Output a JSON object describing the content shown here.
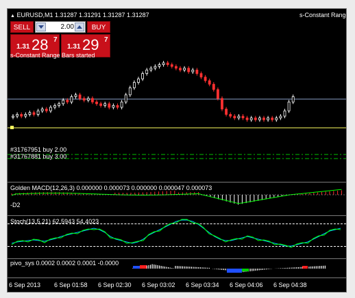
{
  "chart": {
    "symbol_info": "EURUSD,M1  1.31287 1.31291 1.31287 1.31287",
    "indicator_name_right": "s-Constant Range",
    "status_text": "s-Constant Range Bars started",
    "order1": "#31767951 buy 2.00",
    "order2": "#31767881 buy 3.00"
  },
  "trade_panel": {
    "sell_label": "SELL",
    "buy_label": "BUY",
    "lot_value": "2.00",
    "sell_small": "1.31",
    "sell_big": "28",
    "sell_sup": "7",
    "buy_small": "1.31",
    "buy_big": "29",
    "buy_sup": "7"
  },
  "macd": {
    "label": "Golden MACD(12,26,3) 0.000000 0.000073 0.000000 0.000047 0.000073",
    "sub_label": "-D2"
  },
  "stoch": {
    "label": "Stoch(13,5,21) 62.5943 54.4023"
  },
  "bottom_ind": {
    "label": "pivo_sys 0.0002 0.0002 0.0001 -0.0000"
  },
  "time_axis": [
    "6 Sep 2013",
    "6 Sep 01:58",
    "6 Sep 02:30",
    "6 Sep 03:02",
    "6 Sep 03:34",
    "6 Sep 04:06",
    "6 Sep 04:38"
  ],
  "colors": {
    "candle_up": "#ffffff",
    "candle_down": "#ff3030",
    "hline_blue": "#8aa0c8",
    "hline_yellow": "#ffff60",
    "order_line": "#00c000"
  },
  "price_series": [
    {
      "o": 0,
      "c": 0
    },
    {
      "o": 0,
      "c": 1
    },
    {
      "o": 1,
      "c": 0
    },
    {
      "o": 0,
      "c": 1
    },
    {
      "o": 1,
      "c": 2
    },
    {
      "o": 2,
      "c": 1
    },
    {
      "o": 1,
      "c": 3
    },
    {
      "o": 3,
      "c": 4
    },
    {
      "o": 4,
      "c": 3
    },
    {
      "o": 3,
      "c": 5
    },
    {
      "o": 5,
      "c": 6
    },
    {
      "o": 6,
      "c": 7
    },
    {
      "o": 7,
      "c": 9
    },
    {
      "o": 9,
      "c": 8
    },
    {
      "o": 8,
      "c": 11
    },
    {
      "o": 11,
      "c": 12
    },
    {
      "o": 12,
      "c": 10
    },
    {
      "o": 10,
      "c": 9
    },
    {
      "o": 9,
      "c": 10
    },
    {
      "o": 10,
      "c": 8
    },
    {
      "o": 8,
      "c": 7
    },
    {
      "o": 7,
      "c": 6
    },
    {
      "o": 6,
      "c": 7
    },
    {
      "o": 7,
      "c": 5
    },
    {
      "o": 5,
      "c": 6
    },
    {
      "o": 6,
      "c": 5
    },
    {
      "o": 5,
      "c": 8
    },
    {
      "o": 8,
      "c": 12
    },
    {
      "o": 12,
      "c": 16
    },
    {
      "o": 16,
      "c": 19
    },
    {
      "o": 19,
      "c": 21
    },
    {
      "o": 21,
      "c": 24
    },
    {
      "o": 24,
      "c": 26
    },
    {
      "o": 26,
      "c": 27
    },
    {
      "o": 27,
      "c": 28
    },
    {
      "o": 28,
      "c": 29
    },
    {
      "o": 29,
      "c": 30
    },
    {
      "o": 30,
      "c": 29
    },
    {
      "o": 29,
      "c": 28
    },
    {
      "o": 28,
      "c": 27
    },
    {
      "o": 27,
      "c": 26
    },
    {
      "o": 26,
      "c": 27
    },
    {
      "o": 27,
      "c": 25
    },
    {
      "o": 25,
      "c": 26
    },
    {
      "o": 26,
      "c": 24
    },
    {
      "o": 24,
      "c": 22
    },
    {
      "o": 22,
      "c": 20
    },
    {
      "o": 20,
      "c": 18
    },
    {
      "o": 18,
      "c": 15
    },
    {
      "o": 15,
      "c": 10
    },
    {
      "o": 10,
      "c": 4
    },
    {
      "o": 4,
      "c": 1
    },
    {
      "o": 1,
      "c": 0
    },
    {
      "o": 0,
      "c": -1
    },
    {
      "o": -1,
      "c": 0
    },
    {
      "o": 0,
      "c": -1
    },
    {
      "o": -1,
      "c": -2
    },
    {
      "o": -2,
      "c": -1
    },
    {
      "o": -1,
      "c": -2
    },
    {
      "o": -2,
      "c": -1
    },
    {
      "o": -1,
      "c": -2
    },
    {
      "o": -2,
      "c": -1
    },
    {
      "o": -1,
      "c": -2
    },
    {
      "o": -2,
      "c": -1
    },
    {
      "o": -1,
      "c": 0
    },
    {
      "o": 0,
      "c": 3
    },
    {
      "o": 3,
      "c": 8
    },
    {
      "o": 8,
      "c": 11
    }
  ]
}
